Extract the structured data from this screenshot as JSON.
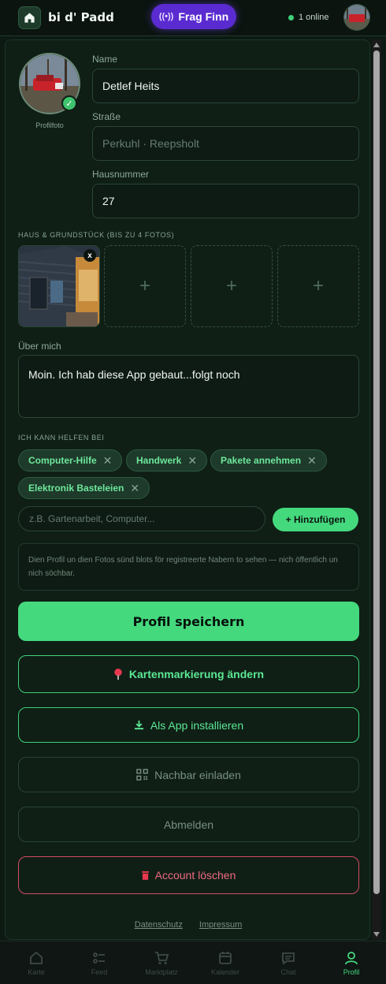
{
  "header": {
    "title": "bi d' Padd",
    "finn_button": "Frag Finn",
    "online_status": "1 online",
    "online_dot_color": "#3fd17a"
  },
  "profile": {
    "photo_label": "Profilfoto",
    "name_label": "Name",
    "name_value": "Detlef Heits",
    "street_label": "Straße",
    "street_placeholder": "Perkuhl · Reepsholt",
    "house_number_label": "Hausnummer",
    "house_number_value": "27"
  },
  "photos": {
    "section_label": "HAUS & GRUNDSTÜCK (BIS ZU 4 FOTOS)",
    "remove_label": "x",
    "add_label": "+"
  },
  "about": {
    "label": "Über mich",
    "value": "Moin. Ich hab diese App gebaut...folgt noch"
  },
  "skills": {
    "section_label": "ICH KANN HELFEN BEI",
    "chips": [
      "Computer-Hilfe",
      "Handwerk",
      "Pakete annehmen",
      "Elektronik Basteleien"
    ],
    "remove_glyph": "✕",
    "input_placeholder": "z.B. Gartenarbeit, Computer...",
    "add_button": "+ Hinzufügen"
  },
  "privacy_note": "Dien Profil un dien Fotos sünd blots för registreerte Nabern to sehen — nich öffentlich un nich söchbar.",
  "actions": {
    "save": "Profil speichern",
    "map_marker": "Kartenmarkierung ändern",
    "install_app": "Als App installieren",
    "invite_neighbor": "Nachbar einladen",
    "logout": "Abmelden",
    "delete_account": "Account löschen"
  },
  "footer": {
    "privacy": "Datenschutz",
    "imprint": "Impressum"
  },
  "nav": {
    "items": [
      "Karte",
      "Feed",
      "Marktplatz",
      "Kalender",
      "Chat",
      "Profil"
    ],
    "active": "Profil"
  },
  "colors": {
    "accent": "#45d97e",
    "finn_purple": "#5a2bd0",
    "danger": "#f06a80",
    "background": "#0d1a13"
  }
}
